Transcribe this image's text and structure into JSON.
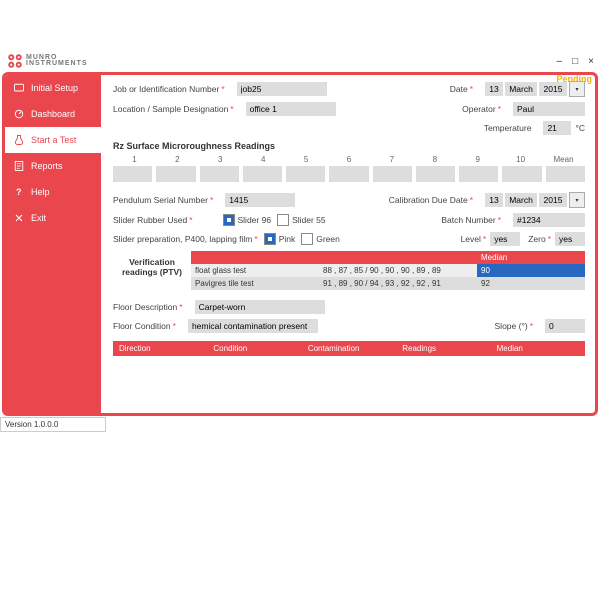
{
  "brand": {
    "name": "MUNRO",
    "sub": "INSTRUMENTS"
  },
  "window": {
    "pending": "Pending",
    "min": "–",
    "max": "□",
    "close": "×"
  },
  "sidebar": {
    "items": [
      {
        "label": "Initial Setup"
      },
      {
        "label": "Dashboard"
      },
      {
        "label": "Start a Test"
      },
      {
        "label": "Reports"
      },
      {
        "label": "Help"
      },
      {
        "label": "Exit"
      }
    ],
    "version": "Version 1.0.0.0"
  },
  "form": {
    "job_lbl": "Job or Identification  Number",
    "job_val": "job25",
    "loc_lbl": "Location / Sample Designation",
    "loc_val": "office 1",
    "date_lbl": "Date",
    "date_d": "13",
    "date_m": "March",
    "date_y": "2015",
    "op_lbl": "Operator",
    "op_val": "Paul",
    "temp_lbl": "Temperature",
    "temp_val": "21",
    "temp_unit": "°C",
    "rz_title": "Rz Surface Microroughness Readings",
    "rz_cols": [
      "1",
      "2",
      "3",
      "4",
      "5",
      "6",
      "7",
      "8",
      "9",
      "10",
      "Mean"
    ],
    "psn_lbl": "Pendulum Serial Number",
    "psn_val": "1415",
    "cdd_lbl": "Calibration Due Date",
    "cdd_d": "13",
    "cdd_m": "March",
    "cdd_y": "2015",
    "sru_lbl": "Slider Rubber Used",
    "sl96": "Slider 96",
    "sl55": "Slider 55",
    "batch_lbl": "Batch Number",
    "batch_val": "#1234",
    "sp_lbl": "Slider preparation, P400, lapping film",
    "pink": "Pink",
    "green": "Green",
    "level_lbl": "Level",
    "level_val": "yes",
    "zero_lbl": "Zero",
    "zero_val": "yes",
    "median_hdr": "Median",
    "ver_label": "Verification readings (PTV)",
    "ver_rows": [
      {
        "name": "float glass test",
        "vals": "88 , 87 , 85 / 90 , 90 , 90 , 89 , 89",
        "median": "90"
      },
      {
        "name": "Pavigres tile test",
        "vals": "91 , 89 , 90 / 94 , 93 , 92 , 92 , 91",
        "median": "92"
      }
    ],
    "floor_desc_lbl": "Floor Description",
    "floor_desc_val": "Carpet-worn",
    "floor_cond_lbl": "Floor Condition",
    "floor_cond_val": "hemical contamination present",
    "slope_lbl": "Slope (°)",
    "slope_val": "0",
    "foot": [
      "Direction",
      "Condition",
      "Contamination",
      "Readings",
      "Median"
    ]
  }
}
